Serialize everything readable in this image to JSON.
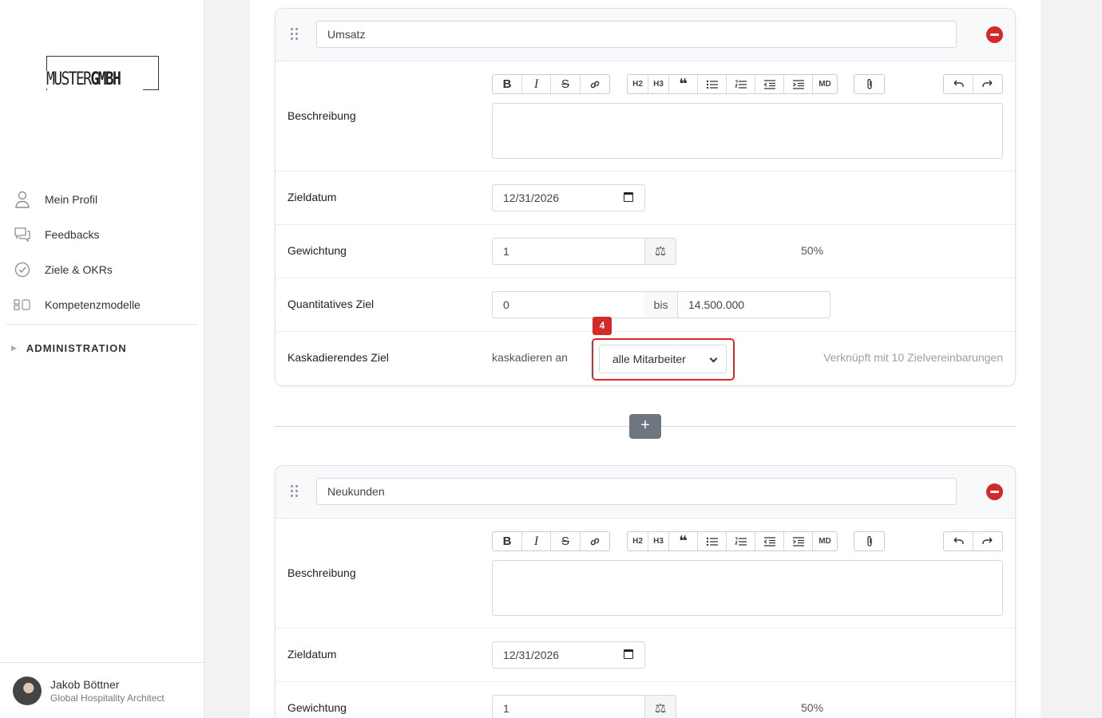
{
  "brand": {
    "part1": "MUSTER",
    "part2": "GMBH"
  },
  "sidebar": {
    "items": [
      {
        "label": "Mein Profil",
        "icon": "user-icon"
      },
      {
        "label": "Feedbacks",
        "icon": "chat-bubbles-icon"
      },
      {
        "label": "Ziele & OKRs",
        "icon": "check-circle-icon"
      },
      {
        "label": "Kompetenzmodelle",
        "icon": "modules-icon"
      }
    ],
    "admin_label": "ADMINISTRATION"
  },
  "user": {
    "name": "Jakob Böttner",
    "role": "Global Hospitality Architect"
  },
  "toolbar": {
    "h2": "H2",
    "h3": "H3",
    "md": "MD"
  },
  "goals": [
    {
      "title": "Umsatz",
      "labels": {
        "description": "Beschreibung",
        "due": "Zieldatum",
        "weight": "Gewichtung",
        "quant": "Quantitatives Ziel",
        "cascade": "Kaskadierendes Ziel"
      },
      "due_date": "12/31/2026",
      "weight": "1",
      "weight_percent": "50%",
      "quant_from": "0",
      "quant_sep": "bis",
      "quant_to": "14.500.000",
      "cascade_label": "kaskadieren an",
      "cascade_value": "alle Mitarbeiter",
      "linked_text": "Verknüpft mit 10 Zielvereinbarungen"
    },
    {
      "title": "Neukunden",
      "labels": {
        "description": "Beschreibung",
        "due": "Zieldatum",
        "weight": "Gewichtung"
      },
      "due_date": "12/31/2026",
      "weight": "1",
      "weight_percent": "50%"
    }
  ],
  "annotation_badge": "4",
  "add_label": "+",
  "colors": {
    "accent_red": "#d42a2a",
    "add_button": "#6e7780"
  }
}
